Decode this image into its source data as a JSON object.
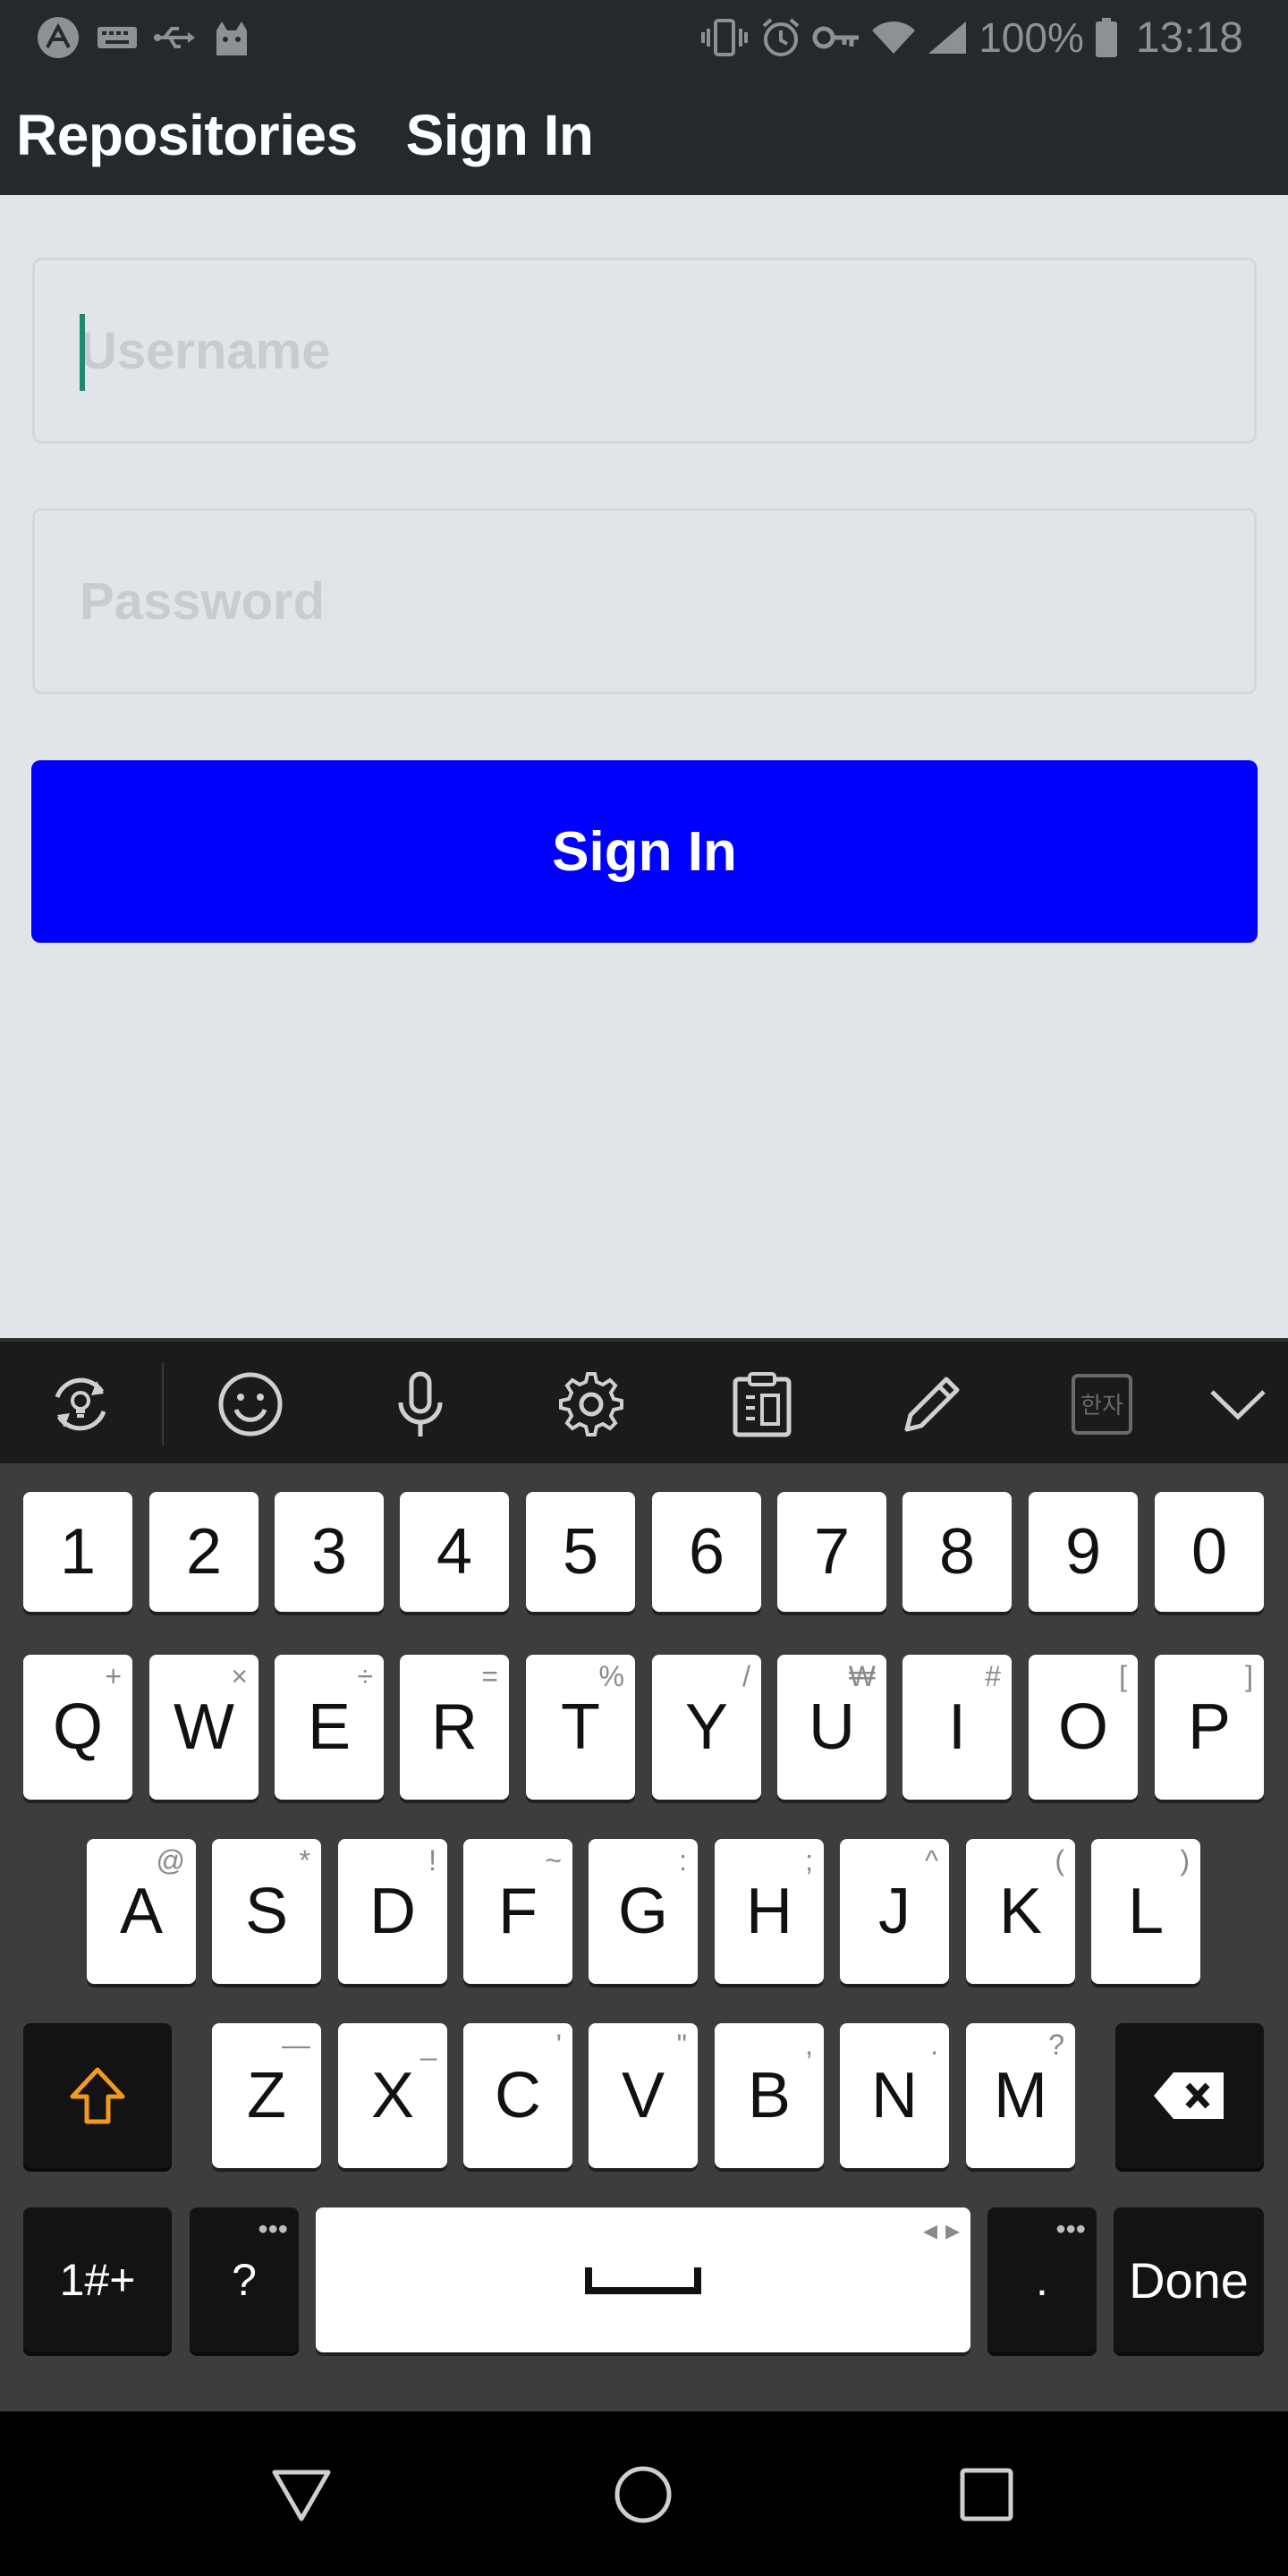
{
  "status_bar": {
    "icons_left": [
      "expo-icon",
      "keyboard-icon",
      "usb-icon",
      "cat-icon"
    ],
    "icons_right": [
      "vibrate-icon",
      "alarm-icon",
      "key-icon",
      "wifi-icon",
      "signal-icon"
    ],
    "battery": "100%",
    "time": "13:18"
  },
  "header": {
    "tabs": [
      {
        "label": "Repositories"
      },
      {
        "label": "Sign In"
      }
    ]
  },
  "form": {
    "username_placeholder": "Username",
    "username_value": "",
    "password_placeholder": "Password",
    "password_value": "",
    "submit_label": "Sign In",
    "submit_color": "#0000fe"
  },
  "keyboard_toolbar": {
    "icons": [
      "switch-keyboard-icon",
      "emoji-icon",
      "microphone-icon",
      "settings-gear-icon",
      "clipboard-icon",
      "pen-icon",
      "hanja-icon",
      "chevron-down-icon"
    ],
    "hanja_label": "한자"
  },
  "keyboard": {
    "number_row": [
      "1",
      "2",
      "3",
      "4",
      "5",
      "6",
      "7",
      "8",
      "9",
      "0"
    ],
    "row1": [
      {
        "k": "Q",
        "s": "+"
      },
      {
        "k": "W",
        "s": "×"
      },
      {
        "k": "E",
        "s": "÷"
      },
      {
        "k": "R",
        "s": "="
      },
      {
        "k": "T",
        "s": "%"
      },
      {
        "k": "Y",
        "s": "/"
      },
      {
        "k": "U",
        "s": "₩"
      },
      {
        "k": "I",
        "s": "#"
      },
      {
        "k": "O",
        "s": "["
      },
      {
        "k": "P",
        "s": "]"
      }
    ],
    "row2": [
      {
        "k": "A",
        "s": "@"
      },
      {
        "k": "S",
        "s": "*"
      },
      {
        "k": "D",
        "s": "!"
      },
      {
        "k": "F",
        "s": "~"
      },
      {
        "k": "G",
        "s": ":"
      },
      {
        "k": "H",
        "s": ";"
      },
      {
        "k": "J",
        "s": "^"
      },
      {
        "k": "K",
        "s": "("
      },
      {
        "k": "L",
        "s": ")"
      }
    ],
    "row3": [
      {
        "k": "Z",
        "s": "—"
      },
      {
        "k": "X",
        "s": "_"
      },
      {
        "k": "C",
        "s": "'"
      },
      {
        "k": "V",
        "s": "\""
      },
      {
        "k": "B",
        "s": ","
      },
      {
        "k": "N",
        "s": "."
      },
      {
        "k": "M",
        "s": "?"
      }
    ],
    "symbols_label": "1#+",
    "question_label": "?",
    "period_label": ".",
    "done_label": "Done",
    "more_dots": "•••",
    "space_arrows": "◂ ▸",
    "shift_color": "#f29a1c"
  },
  "navbar": {
    "icons": [
      "back-triangle-icon",
      "home-circle-icon",
      "recents-square-icon"
    ]
  }
}
